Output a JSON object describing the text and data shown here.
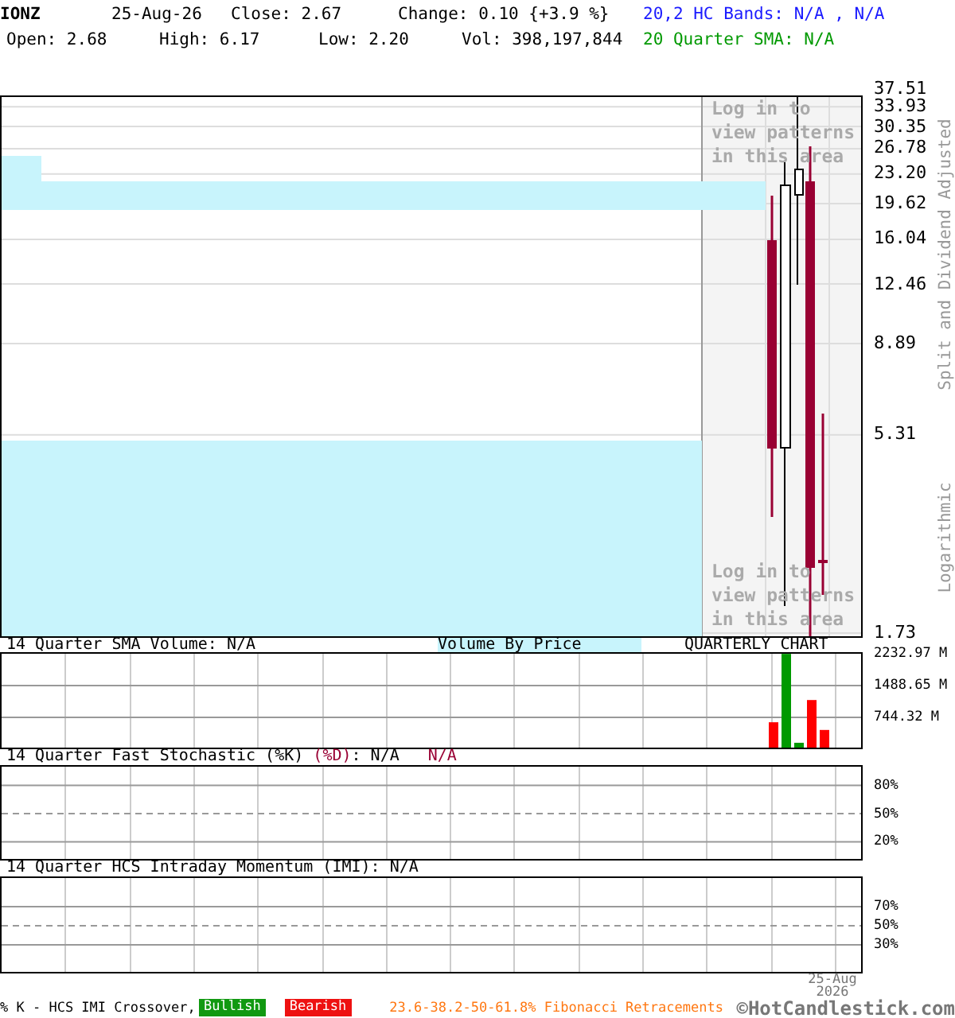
{
  "header": {
    "symbol": "IONZ",
    "date": "25-Aug-26",
    "close": "Close: 2.67",
    "change": "Change: 0.10 {+3.9 %}",
    "open": "Open: 2.68",
    "high": "High: 6.17",
    "low": "Low: 2.20",
    "volume": "Vol: 398,197,844",
    "bands": "20,2 HC Bands: N/A , N/A",
    "sma": "20 Quarter SMA: N/A"
  },
  "price_chart": {
    "y_ticks": [
      "37.51",
      "33.93",
      "30.35",
      "26.78",
      "23.20",
      "19.62",
      "16.04",
      "12.46",
      "8.89",
      "5.31",
      "1.73"
    ],
    "locked_notes": [
      "Log in to view patterns in this area",
      "Log in to view patterns in this area"
    ],
    "axis_notes": [
      "Split and Dividend Adjusted",
      "Logarithmic"
    ]
  },
  "volume_panel": {
    "title": "14 Quarter SMA Volume: N/A",
    "volume_by_price": "Volume By Price",
    "period": "QUARTERLY CHART",
    "chart_data": {
      "type": "bar",
      "stacked": true,
      "ylim": [
        0,
        2232.97
      ],
      "yticks": [
        {
          "value": 2232.97,
          "label": "2232.97 M"
        },
        {
          "value": 1488.65,
          "label": "1488.65 M"
        },
        {
          "value": 744.32,
          "label": "744.32 M"
        }
      ],
      "series": [
        {
          "color": "#ff0000",
          "values": [
            630,
            null,
            null,
            1150,
            450
          ]
        },
        {
          "color": "#009900",
          "values": [
            null,
            2230,
            150,
            null,
            null
          ]
        }
      ]
    }
  },
  "stochastic_panel": {
    "title": "14 Quarter Fast Stochastic (%K)",
    "title_d": "(%D)",
    "k_value": ": N/A",
    "d_value": "N/A",
    "y_ticks": [
      "80%",
      "50%",
      "20%"
    ]
  },
  "momentum_panel": {
    "title": "14 Quarter HCS Intraday Momentum (IMI): N/A",
    "y_ticks": [
      "70%",
      "50%",
      "30%"
    ]
  },
  "date_label": "25-Aug 2026",
  "footer": {
    "legend": "% K - HCS IMI Crossover,",
    "bullish": "Bullish",
    "bearish": "Bearish",
    "fibonacci": "23.6-38.2-50-61.8% Fibonacci Retracements",
    "copyright": "©HotCandlestick.com"
  }
}
